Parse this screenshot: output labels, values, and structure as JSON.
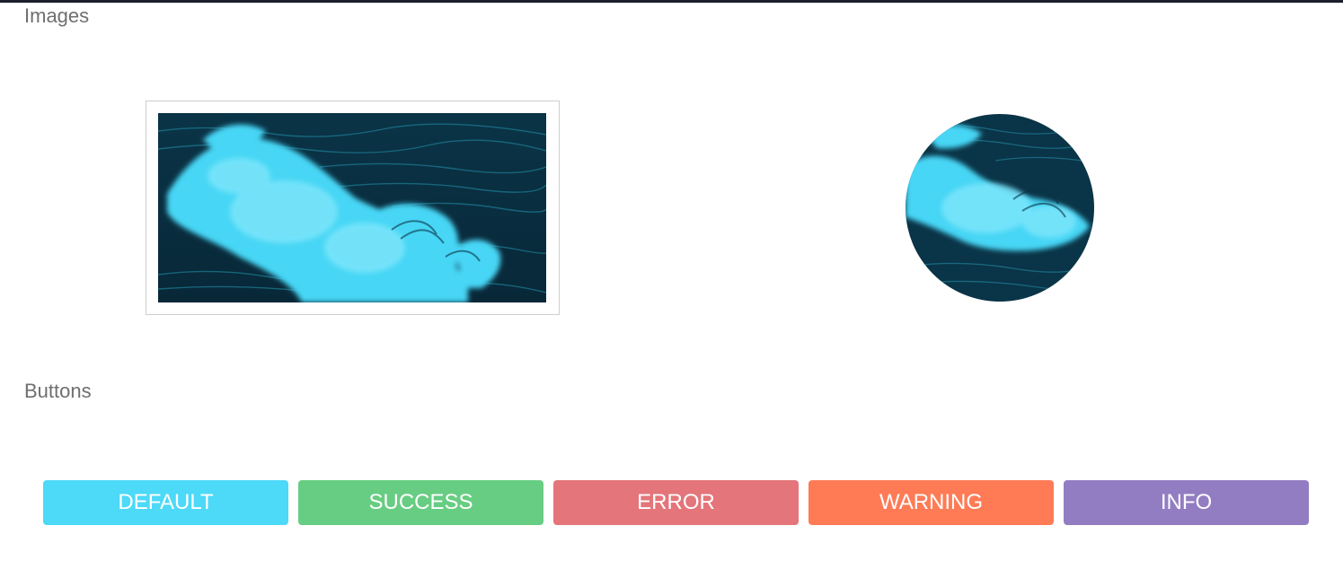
{
  "sections": {
    "images_title": "Images",
    "buttons_title": "Buttons"
  },
  "images": {
    "thumbnail": {
      "subject": "ocean wave",
      "style": "bordered-thumbnail"
    },
    "circle": {
      "subject": "ocean wave",
      "style": "circular"
    }
  },
  "buttons": [
    {
      "label": "DEFAULT",
      "color": "#4dd9f8"
    },
    {
      "label": "SUCCESS",
      "color": "#67cd82"
    },
    {
      "label": "ERROR",
      "color": "#e4757a"
    },
    {
      "label": "WARNING",
      "color": "#fe7b56"
    },
    {
      "label": "INFO",
      "color": "#937dc2"
    }
  ]
}
